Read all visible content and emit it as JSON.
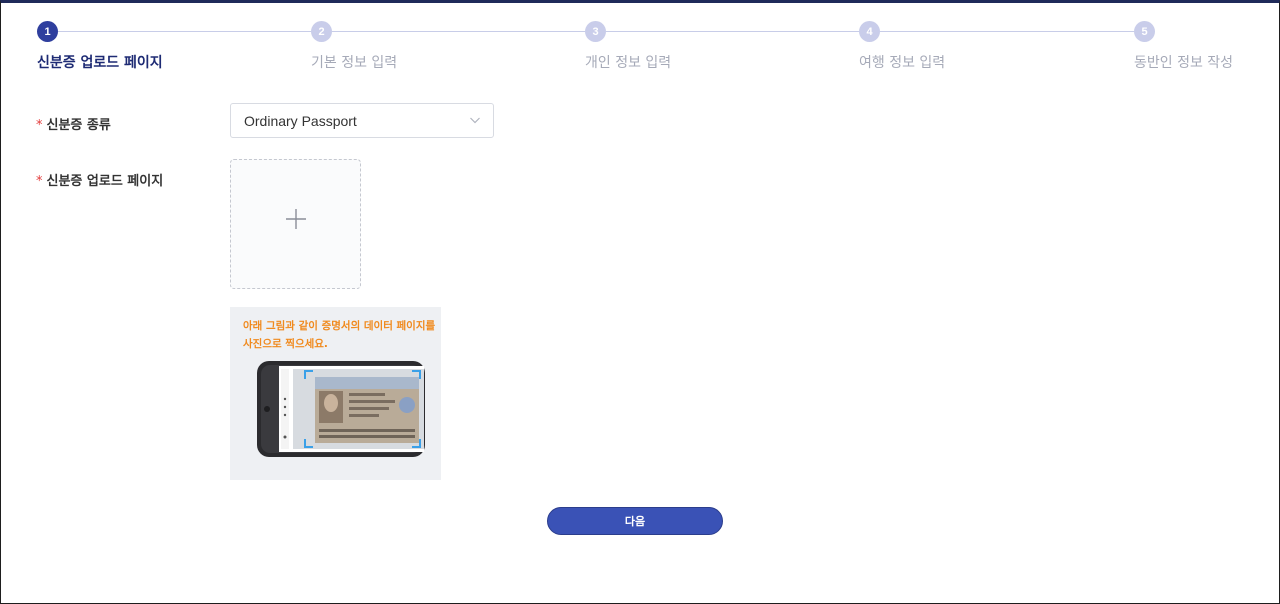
{
  "steps": [
    {
      "number": "1",
      "label": "신분증 업로드 페이지",
      "active": true
    },
    {
      "number": "2",
      "label": "기본 정보 입력",
      "active": false
    },
    {
      "number": "3",
      "label": "개인 정보 입력",
      "active": false
    },
    {
      "number": "4",
      "label": "여행 정보 입력",
      "active": false
    },
    {
      "number": "5",
      "label": "동반인 정보 작성",
      "active": false
    }
  ],
  "form": {
    "required_mark": "*",
    "id_type_label": "신분증 종류",
    "id_type_value": "Ordinary Passport",
    "upload_label": "신분증 업로드 페이지",
    "guide_text": "아래 그림과 같이 증명서의 데이터 페이지를 사진으로 찍으세요."
  },
  "next_button": "다음",
  "colors": {
    "accent": "#3a52b6",
    "step_active": "#2f3f9e",
    "step_inactive": "#c9cdea",
    "required": "#e23b3b",
    "guide_text": "#f08a1e"
  },
  "icons": {
    "select": "chevron-down-icon",
    "upload": "plus-icon",
    "guide": "phone-passport-illustration"
  }
}
